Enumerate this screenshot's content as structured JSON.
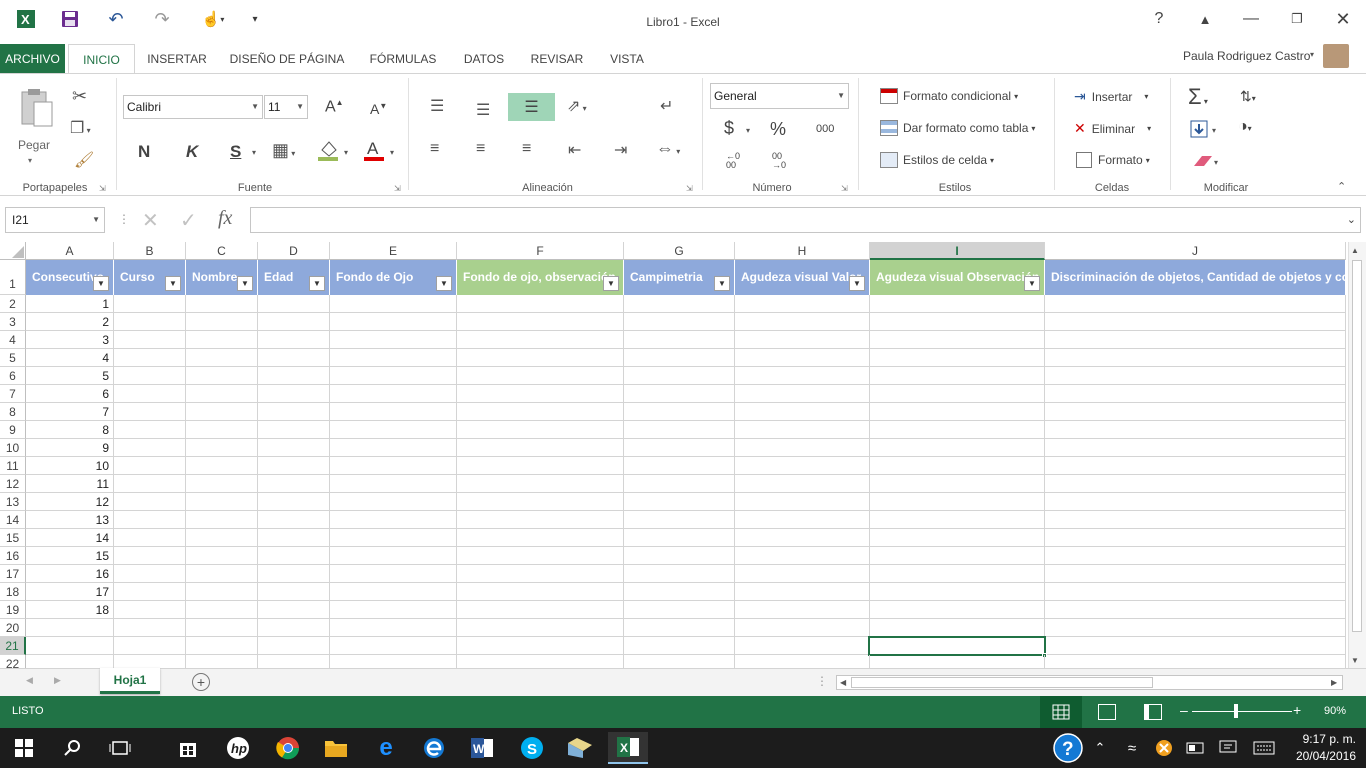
{
  "app": {
    "title": "Libro1 - Excel",
    "user": "Paula Rodriguez Castro"
  },
  "tabs": [
    "ARCHIVO",
    "INICIO",
    "INSERTAR",
    "DISEÑO DE PÁGINA",
    "FÓRMULAS",
    "DATOS",
    "REVISAR",
    "VISTA"
  ],
  "ribbon": {
    "clipboard": {
      "paste": "Pegar",
      "label": "Portapapeles"
    },
    "font": {
      "name": "Calibri",
      "size": "11",
      "bold": "N",
      "italic": "K",
      "underline": "S",
      "label": "Fuente"
    },
    "alignment": {
      "label": "Alineación"
    },
    "number": {
      "format": "General",
      "currency": "$",
      "percent": "%",
      "thousands": "000",
      "inc_decimal": "←0\n00",
      "dec_decimal": "00\n→0",
      "label": "Número"
    },
    "styles": {
      "conditional": "Formato condicional",
      "as_table": "Dar formato como tabla",
      "cell_styles": "Estilos de celda",
      "label": "Estilos"
    },
    "cells": {
      "insert": "Insertar",
      "delete": "Eliminar",
      "format": "Formato",
      "label": "Celdas"
    },
    "editing": {
      "label": "Modificar"
    }
  },
  "formula": {
    "namebox": "I21",
    "fx": "fx",
    "value": ""
  },
  "columns": [
    "A",
    "B",
    "C",
    "D",
    "E",
    "F",
    "G",
    "H",
    "I",
    "J"
  ],
  "headers": [
    "Consecutivo",
    "Curso",
    "Nombre",
    "Edad",
    "Fondo de Ojo",
    "Fondo de ojo, observación",
    "Campimetria",
    "Agudeza visual Valor",
    "Agudeza visual Observación",
    "Discriminación de objetos, Cantidad de objetos y colores"
  ],
  "rows": [
    "1",
    "2",
    "3",
    "4",
    "5",
    "6",
    "7",
    "8",
    "9",
    "10",
    "11",
    "12",
    "13",
    "14",
    "15",
    "16",
    "17",
    "18",
    "19",
    "20",
    "21",
    "22"
  ],
  "col_a_values": [
    "1",
    "2",
    "3",
    "4",
    "5",
    "6",
    "7",
    "8",
    "9",
    "10",
    "11",
    "12",
    "13",
    "14",
    "15",
    "16",
    "17",
    "18"
  ],
  "colors": {
    "excel_green": "#217346",
    "header_blue": "#8ea9db",
    "header_green": "#a9d08e"
  },
  "sheet": {
    "name": "Hoja1"
  },
  "status": {
    "ready": "LISTO",
    "zoom": "90%"
  },
  "clock": {
    "time": "9:17 p. m.",
    "date": "20/04/2016"
  }
}
